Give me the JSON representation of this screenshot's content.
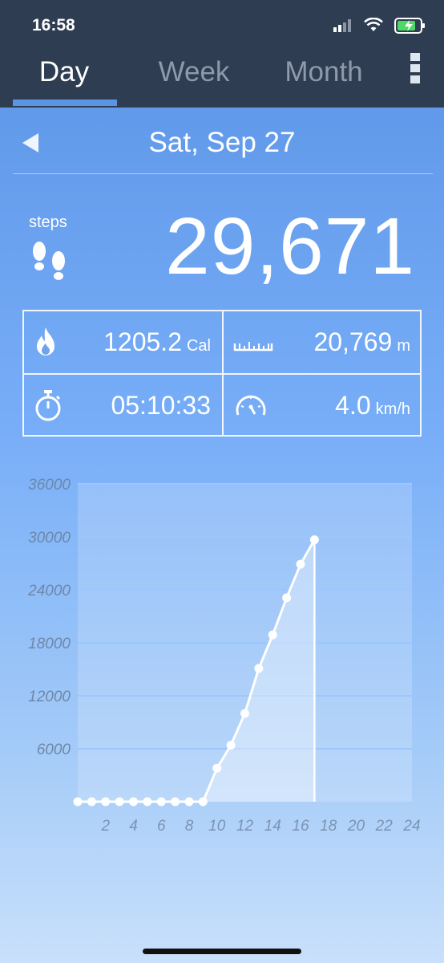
{
  "status_bar": {
    "time": "16:58"
  },
  "tabs": [
    {
      "label": "Day",
      "active": true
    },
    {
      "label": "Week",
      "active": false
    },
    {
      "label": "Month",
      "active": false
    }
  ],
  "date": {
    "label": "Sat, Sep 27"
  },
  "steps": {
    "label": "steps",
    "value": "29,671"
  },
  "stats": {
    "calories": {
      "value": "1205.2",
      "unit": "Cal",
      "icon": "flame-icon"
    },
    "distance": {
      "value": "20,769",
      "unit": "m",
      "icon": "ruler-icon"
    },
    "duration": {
      "value": "05:10:33",
      "unit": "",
      "icon": "stopwatch-icon"
    },
    "speed": {
      "value": "4.0",
      "unit": "km/h",
      "icon": "speedometer-icon"
    }
  },
  "colors": {
    "header_bg": "#2e3d52",
    "tab_active": "#ffffff",
    "tab_inactive": "#8e9aab",
    "tab_underline": "#5b94e0"
  },
  "chart_data": {
    "type": "line",
    "x": [
      0,
      1,
      2,
      3,
      4,
      5,
      6,
      7,
      8,
      9,
      10,
      11,
      12,
      13,
      14,
      15,
      16,
      17
    ],
    "values": [
      0,
      0,
      0,
      0,
      0,
      0,
      0,
      0,
      0,
      0,
      3800,
      6400,
      10000,
      15100,
      18900,
      23100,
      26900,
      29671
    ],
    "y_ticks": [
      "36000",
      "30000",
      "24000",
      "18000",
      "12000",
      "6000"
    ],
    "x_ticks": [
      "2",
      "4",
      "6",
      "8",
      "10",
      "12",
      "14",
      "16",
      "18",
      "20",
      "22",
      "24"
    ],
    "xlim": [
      0,
      24
    ],
    "ylim": [
      0,
      36000
    ],
    "area_fill": true,
    "grid": true
  }
}
